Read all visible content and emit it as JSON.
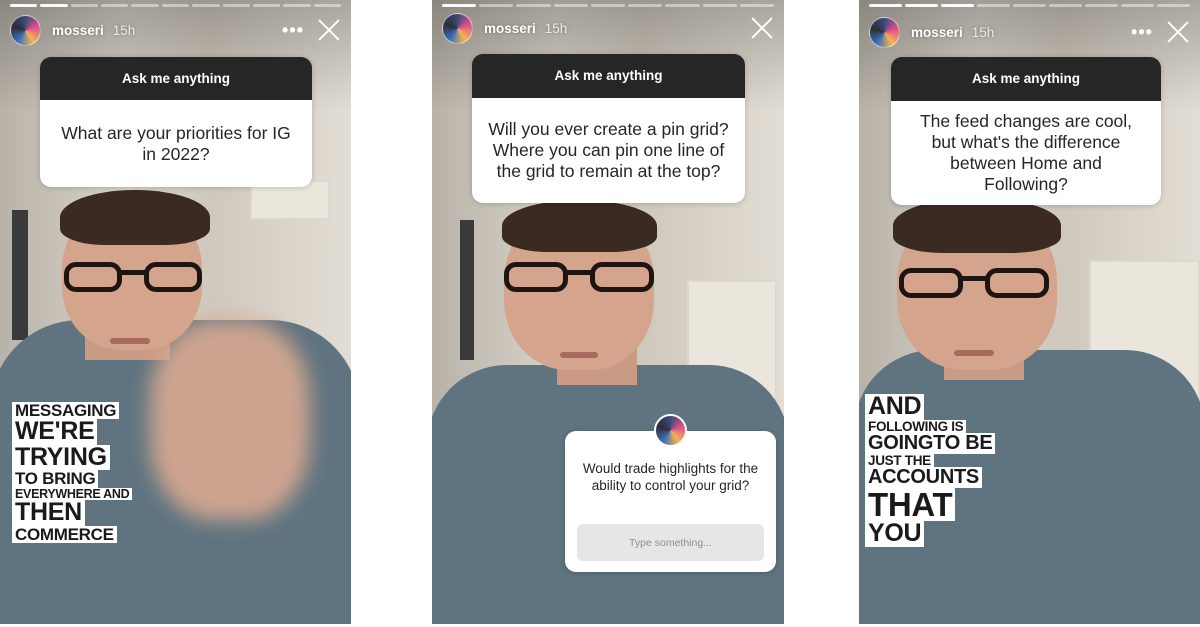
{
  "stories": [
    {
      "username": "mosseri",
      "time": "15h",
      "question_header": "Ask me anything",
      "question": "What are your priorities for IG in 2022?",
      "caption_lines": [
        "MESSAGING",
        "WE'RE",
        "TRYING",
        "TO BRING",
        "EVERYWHERE AND",
        "THEN",
        "COMMERCE"
      ]
    },
    {
      "username": "mosseri",
      "time": "15h",
      "question_header": "Ask me anything",
      "question": "Will you ever create a pin grid? Where you can pin one line of the grid to remain at the top?",
      "reply_question": "Would trade highlights for the ability to control your grid?",
      "reply_placeholder": "Type something..."
    },
    {
      "username": "mosseri",
      "time": "15h",
      "question_header": "Ask me anything",
      "question": "The feed changes are cool, but what's the difference between Home and Following?",
      "caption_lines": [
        "AND",
        "FOLLOWING IS",
        "GOINGTO BE",
        "JUST THE",
        "ACCOUNTS",
        "THAT",
        "YOU"
      ]
    }
  ],
  "icons": {
    "more": "more-dots-icon",
    "close": "close-x-icon"
  },
  "progress": {
    "segments_story1": 11,
    "done_story1": 2,
    "segments_story2": 9,
    "done_story2": 1,
    "segments_story3": 9,
    "done_story3": 3
  }
}
